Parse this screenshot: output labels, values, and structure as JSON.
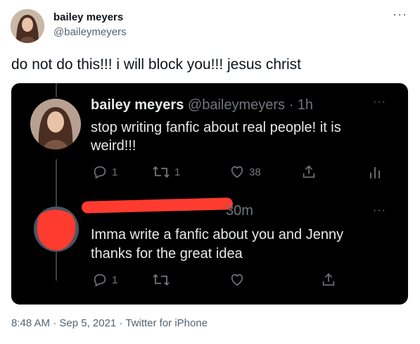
{
  "tweet": {
    "author_name": "bailey meyers",
    "author_handle": "@baileymeyers",
    "more_label": "···",
    "text": "do not do this!!! i will block you!!! jesus christ",
    "footer": "8:48 AM · Sep 5, 2021 · Twitter for iPhone"
  },
  "screenshot": {
    "quoted": {
      "name": "bailey meyers",
      "handle_time": "@baileymeyers · 1h",
      "more_label": "···",
      "text_line1": "stop writing fanfic about real people! it is",
      "text_line2": "weird!!!",
      "reply_count": "1",
      "retweet_count": "1",
      "like_count": "38"
    },
    "reply": {
      "time": "30m",
      "more_label": "···",
      "text_line1": "Imma write a fanfic about you and Jenny",
      "text_line2": "thanks for the great idea",
      "reply_count": "1"
    }
  },
  "colors": {
    "redaction": "#ff3b30",
    "text_primary": "#0f1419",
    "text_secondary": "#536471"
  }
}
